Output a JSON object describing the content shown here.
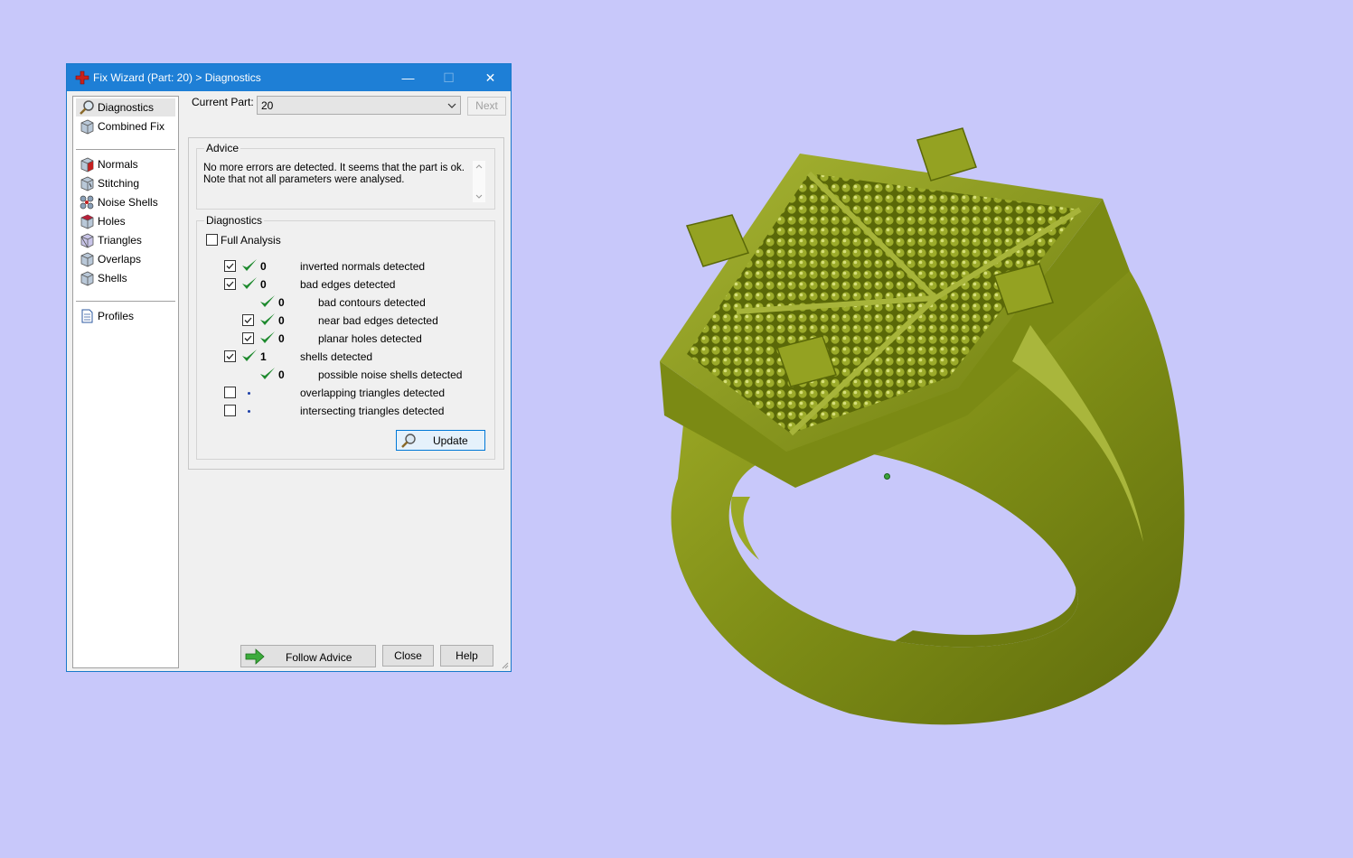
{
  "window": {
    "title": "Fix Wizard (Part: 20) > Diagnostics",
    "minimize_glyph": "—",
    "maximize_glyph": "☐",
    "close_glyph": "✕"
  },
  "nav": {
    "items": [
      {
        "label": "Diagnostics",
        "icon": "magnifier-icon",
        "selected": true
      },
      {
        "label": "Combined Fix",
        "icon": "cube-icon"
      },
      {
        "label": "Normals",
        "icon": "normals-cube-icon"
      },
      {
        "label": "Stitching",
        "icon": "stitching-cube-icon"
      },
      {
        "label": "Noise Shells",
        "icon": "noise-shells-icon"
      },
      {
        "label": "Holes",
        "icon": "holes-cube-icon"
      },
      {
        "label": "Triangles",
        "icon": "triangles-cube-icon"
      },
      {
        "label": "Overlaps",
        "icon": "overlaps-cube-icon"
      },
      {
        "label": "Shells",
        "icon": "shells-cube-icon"
      },
      {
        "label": "Profiles",
        "icon": "document-icon"
      }
    ]
  },
  "current_part": {
    "label": "Current Part:",
    "value": "20",
    "next_label": "Next"
  },
  "advice": {
    "legend": "Advice",
    "line1": "No more errors are detected. It seems that the part is ok.",
    "line2": "Note that not all parameters were analysed."
  },
  "diagnostics": {
    "legend": "Diagnostics",
    "full_analysis_label": "Full Analysis",
    "full_analysis_checked": false,
    "rows": [
      {
        "checked": true,
        "status": "ok",
        "count": "0",
        "label": "inverted normals detected"
      },
      {
        "checked": true,
        "status": "ok",
        "count": "0",
        "label": "bad edges detected"
      },
      {
        "checked": null,
        "status": "ok",
        "count": "0",
        "label": "bad contours detected"
      },
      {
        "checked": true,
        "status": "ok",
        "count": "0",
        "label": "near bad edges detected"
      },
      {
        "checked": true,
        "status": "ok",
        "count": "0",
        "label": "planar holes detected"
      },
      {
        "checked": true,
        "status": "ok",
        "count": "1",
        "label": "shells detected"
      },
      {
        "checked": null,
        "status": "ok",
        "count": "0",
        "label": "possible noise shells detected"
      },
      {
        "checked": false,
        "status": "pending",
        "count": "",
        "label": "overlapping triangles detected"
      },
      {
        "checked": false,
        "status": "pending",
        "count": "",
        "label": "intersecting triangles detected"
      }
    ],
    "update_label": "Update"
  },
  "footer": {
    "follow_advice_label": "Follow Advice",
    "close_label": "Close",
    "help_label": "Help"
  },
  "colors": {
    "background": "#c8c8fa",
    "titlebar": "#1e7fd6",
    "tick_green": "#1e8a2e",
    "model_green": "#8a9a1e"
  }
}
